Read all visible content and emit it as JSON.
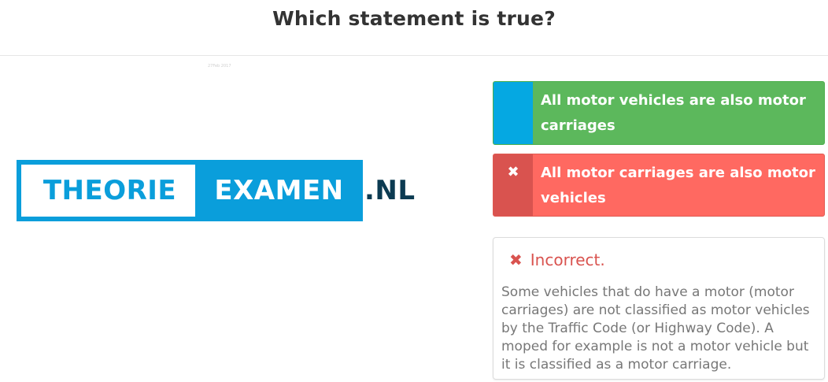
{
  "header": {
    "title": "Which statement is true?"
  },
  "image": {
    "credit": "27Feb 2017"
  },
  "logo": {
    "part1": "THEORIE",
    "part2": "EXAMEN",
    "part3": ".NL"
  },
  "options": [
    {
      "marker": "",
      "text": "All motor vehicles are also motor carriages",
      "state": "correct"
    },
    {
      "marker": "✖",
      "text": "All motor carriages are also motor vehicles",
      "state": "selected-wrong"
    }
  ],
  "feedback": {
    "icon": "✖",
    "heading": "Incorrect.",
    "body": "Some vehicles that do have a motor (motor carriages) are not classified as motor vehicles by the Traffic Code (or Highway Code). A moped for example is not a motor vehicle but it is classified as a motor carriage."
  },
  "colors": {
    "correct": "#5cb85c",
    "wrong": "#ff6961",
    "accent_blue": "#05a8e2",
    "incorrect_text": "#d9534f",
    "logo_blue": "#0a9edb",
    "logo_dark": "#0c3b52"
  }
}
